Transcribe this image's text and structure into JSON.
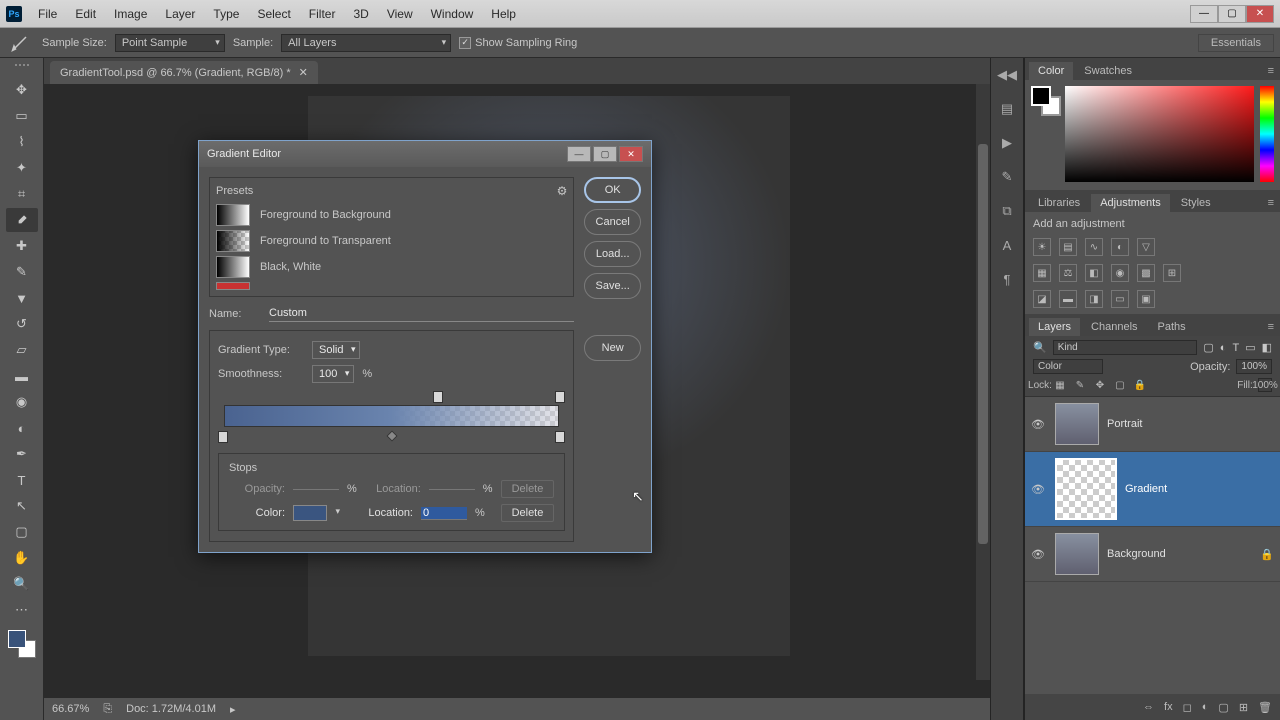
{
  "menu": {
    "items": [
      "File",
      "Edit",
      "Image",
      "Layer",
      "Type",
      "Select",
      "Filter",
      "3D",
      "View",
      "Window",
      "Help"
    ]
  },
  "optionsBar": {
    "sampleSizeLabel": "Sample Size:",
    "sampleSize": "Point Sample",
    "sampleLabel": "Sample:",
    "sample": "All Layers",
    "showSamplingRing": "Show Sampling Ring",
    "workspace": "Essentials"
  },
  "document": {
    "tab": "GradientTool.psd @ 66.7% (Gradient, RGB/8) *"
  },
  "statusbar": {
    "zoom": "66.67%",
    "docinfo": "Doc: 1.72M/4.01M"
  },
  "rightPanels": {
    "color": {
      "tabs": [
        "Color",
        "Swatches"
      ],
      "active": "Color"
    },
    "adjust": {
      "tabs": [
        "Libraries",
        "Adjustments",
        "Styles"
      ],
      "active": "Adjustments",
      "hint": "Add an adjustment"
    },
    "layers": {
      "tabs": [
        "Layers",
        "Channels",
        "Paths"
      ],
      "active": "Layers",
      "kindSearch": "Kind",
      "blend": "Color",
      "opacityLabel": "Opacity:",
      "opacity": "100%",
      "lockLabel": "Lock:",
      "fillLabel": "Fill:",
      "fill": "100%",
      "items": [
        {
          "name": "Portrait"
        },
        {
          "name": "Gradient",
          "selected": true
        },
        {
          "name": "Background",
          "locked": true
        }
      ]
    }
  },
  "dialog": {
    "title": "Gradient Editor",
    "presets": {
      "label": "Presets",
      "items": [
        "Foreground to Background",
        "Foreground to Transparent",
        "Black, White"
      ]
    },
    "buttons": {
      "ok": "OK",
      "cancel": "Cancel",
      "load": "Load...",
      "save": "Save...",
      "new": "New"
    },
    "nameLabel": "Name:",
    "name": "Custom",
    "gradTypeLabel": "Gradient Type:",
    "gradType": "Solid",
    "smoothLabel": "Smoothness:",
    "smooth": "100",
    "pct": "%",
    "stopsLabel": "Stops",
    "opacityStop": {
      "label": "Opacity:",
      "value": "",
      "locLabel": "Location:",
      "loc": "",
      "delete": "Delete"
    },
    "colorStop": {
      "label": "Color:",
      "locLabel": "Location:",
      "loc": "0",
      "delete": "Delete"
    }
  }
}
